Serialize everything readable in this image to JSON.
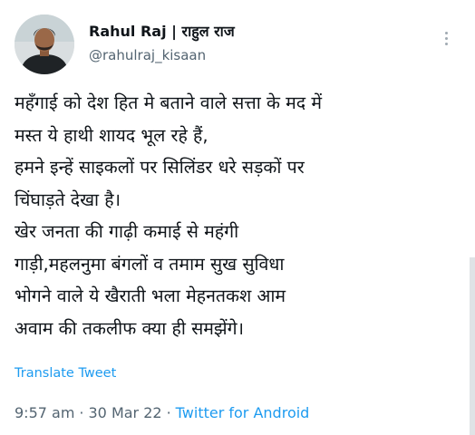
{
  "tweet": {
    "author": {
      "display_name": "Rahul Raj | राहुल राज",
      "handle": "@rahulraj_kisaan"
    },
    "text_lines": [
      "महँगाई को देश हित मे बताने वाले सत्ता के मद में",
      "मस्त ये हाथी शायद भूल रहे हैं,",
      "हमने इन्हें साइकलों पर सिलिंडर धरे सड़कों पर",
      "चिंघाड़ते देखा है।",
      "खेर जनता की गाढ़ी कमाई से महंगी",
      "गाड़ी,महलनुमा बंगलों व तमाम सुख सुविधा",
      "भोगने वाले ये खैराती भला मेहनतकश आम",
      "अवाम की तकलीफ क्या ही समझेंगे।"
    ],
    "translate_label": "Translate Tweet",
    "time": "9:57 am",
    "date": "30 Mar 22",
    "separator": "·",
    "source": "Twitter for Android"
  },
  "icons": {
    "more": "more-horizontal-icon",
    "avatar": "avatar-photo"
  },
  "colors": {
    "text": "#0f1419",
    "secondary": "#536471",
    "link": "#1d9bf0"
  }
}
